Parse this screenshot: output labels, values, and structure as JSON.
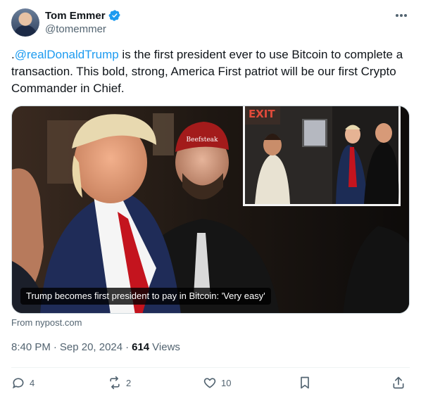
{
  "author": {
    "name": "Tom Emmer",
    "handle": "@tomemmer",
    "verified_icon": "verified-badge-icon",
    "verified_color": "#1d9bf0"
  },
  "tweet": {
    "prefix": ".",
    "mention": "@realDonaldTrump",
    "body": " is the first president ever to use Bitcoin to complete a transaction.  This bold, strong, America First patriot will be our first Crypto Commander in Chief."
  },
  "media": {
    "caption": "Trump becomes first president to pay in Bitcoin: 'Very easy'",
    "inset_sign": "EXIT",
    "hat_text": "Beefsteak"
  },
  "link_source": "From nypost.com",
  "meta": {
    "time": "8:40 PM",
    "date": "Sep 20, 2024",
    "separator": "·",
    "views_count": "614",
    "views_label": "Views"
  },
  "actions": {
    "replies": "4",
    "reposts": "2",
    "likes": "10"
  },
  "colors": {
    "link": "#1d9bf0",
    "secondary_text": "#536471",
    "primary_text": "#0f1419"
  }
}
